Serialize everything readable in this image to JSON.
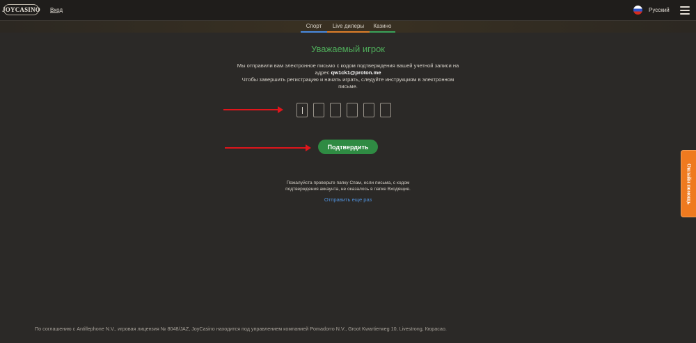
{
  "header": {
    "logo_text": "JOYCASINO",
    "login_label": "Вход",
    "language_label": "Русский"
  },
  "tabs": [
    {
      "label": "Спорт",
      "color": "#4a8be0"
    },
    {
      "label": "Live дилеры",
      "color": "#e07f2a"
    },
    {
      "label": "Казино",
      "color": "#3aa35a"
    }
  ],
  "verification": {
    "title": "Уважаемый игрок",
    "message_part1": "Мы отправили вам электронное письмо с кодом подтверждения вашей учетной записи на адрес",
    "email": "qw1ck1@proton.me",
    "message_part2": "Чтобы завершить регистрацию и начать играть, следуйте инструкциям в электронном письме.",
    "code_digits": [
      "",
      "",
      "",
      "",
      "",
      ""
    ],
    "confirm_label": "Подтвердить",
    "spam_note": "Пожалуйста проверьте папку Спам, если письма, с кодом подтверждения аккаунта, не оказалось в папке Входящие.",
    "resend_label": "Отправить еще раз"
  },
  "help_tab": {
    "label": "Онлайн помощь"
  },
  "footer": {
    "text": "По соглашению с Antillephone N.V., игровая лицензия № 8048/JAZ, JoyCasino находится под управлением компанией Pomadorro N.V., Groot Kwartierweg 10, Livestrong, Кюрасао."
  },
  "colors": {
    "background": "#2b2927",
    "accent_green": "#2f8b43",
    "title_green": "#4fae5b",
    "link_blue": "#4f8fd8",
    "help_orange": "#ef7a1f",
    "annotation_red": "#e0151b"
  },
  "icons": [
    "russia-flag-icon",
    "hamburger-menu-icon"
  ]
}
